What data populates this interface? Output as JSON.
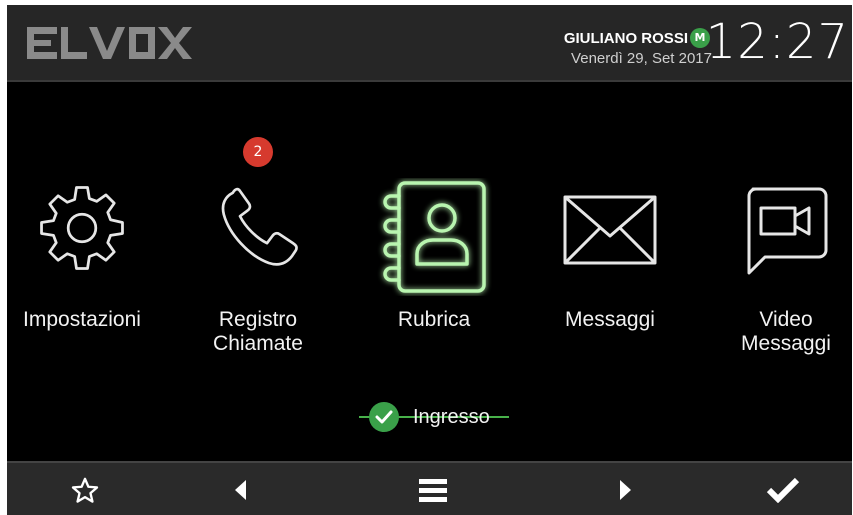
{
  "header": {
    "logo_text": "ELVOX",
    "user_name": "GIULIANO ROSSI",
    "status_letter": "M",
    "date": "Venerdì 29, Set 2017",
    "clock": "12:27"
  },
  "apps": [
    {
      "label_line1": "Impostazioni",
      "label_line2": "",
      "icon": "gear-icon"
    },
    {
      "label_line1": "Registro",
      "label_line2": "Chiamate",
      "icon": "phone-icon",
      "badge": "2"
    },
    {
      "label_line1": "Rubrica",
      "label_line2": "",
      "icon": "address-book-icon",
      "active": true
    },
    {
      "label_line1": "Messaggi",
      "label_line2": "",
      "icon": "envelope-icon"
    },
    {
      "label_line1": "Video",
      "label_line2": "Messaggi",
      "icon": "video-message-icon"
    }
  ],
  "entrance": {
    "label": "Ingresso",
    "checked": true
  },
  "bottombar": [
    "star-icon",
    "arrow-left-icon",
    "menu-icon",
    "arrow-right-icon",
    "check-icon"
  ],
  "colors": {
    "accent": "#48b14a",
    "badge": "#d63a2e",
    "background": "#000000",
    "bar": "#262626"
  }
}
